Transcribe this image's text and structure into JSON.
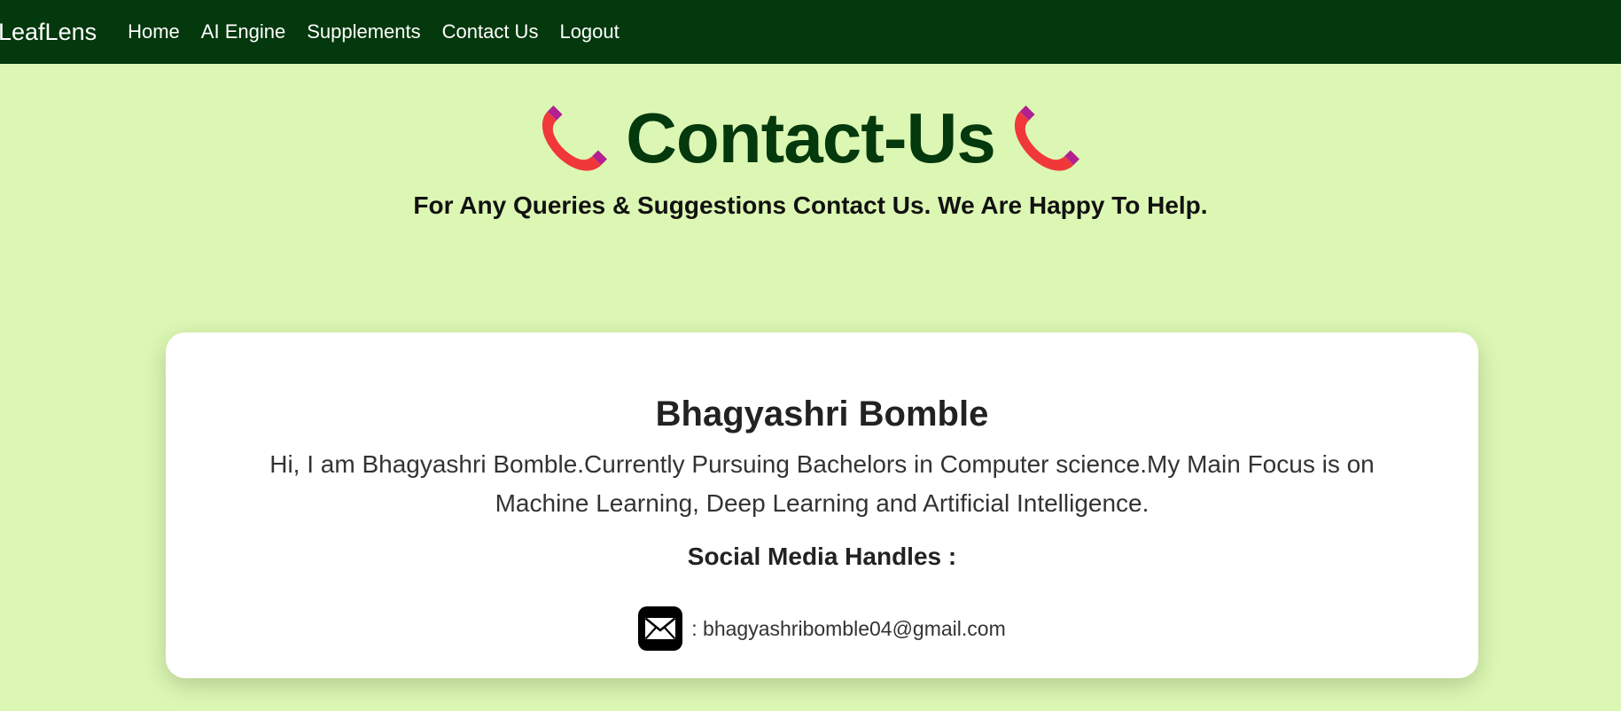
{
  "nav": {
    "brand": "LeafLens",
    "links": [
      "Home",
      "AI Engine",
      "Supplements",
      "Contact Us",
      "Logout"
    ],
    "background": "#04380d"
  },
  "hero": {
    "title": "Contact-Us",
    "subtitle": "For Any Queries & Suggestions Contact Us. We Are Happy To Help.",
    "icon": "telephone-receiver-icon"
  },
  "card": {
    "name": "Bhagyashri Bomble",
    "bio": "Hi, I am Bhagyashri Bomble.Currently Pursuing Bachelors in Computer science.My Main Focus is on Machine Learning, Deep Learning and Artificial Intelligence.",
    "social_heading": "Social Media Handles :",
    "email_label": ": bhagyashribomble04@gmail.com",
    "email_icon": "envelope-icon"
  },
  "colors": {
    "page_background": "#dcf7b3",
    "title_color": "#04380d",
    "phone_red": "#f0383a",
    "phone_purple": "#b3208f"
  }
}
